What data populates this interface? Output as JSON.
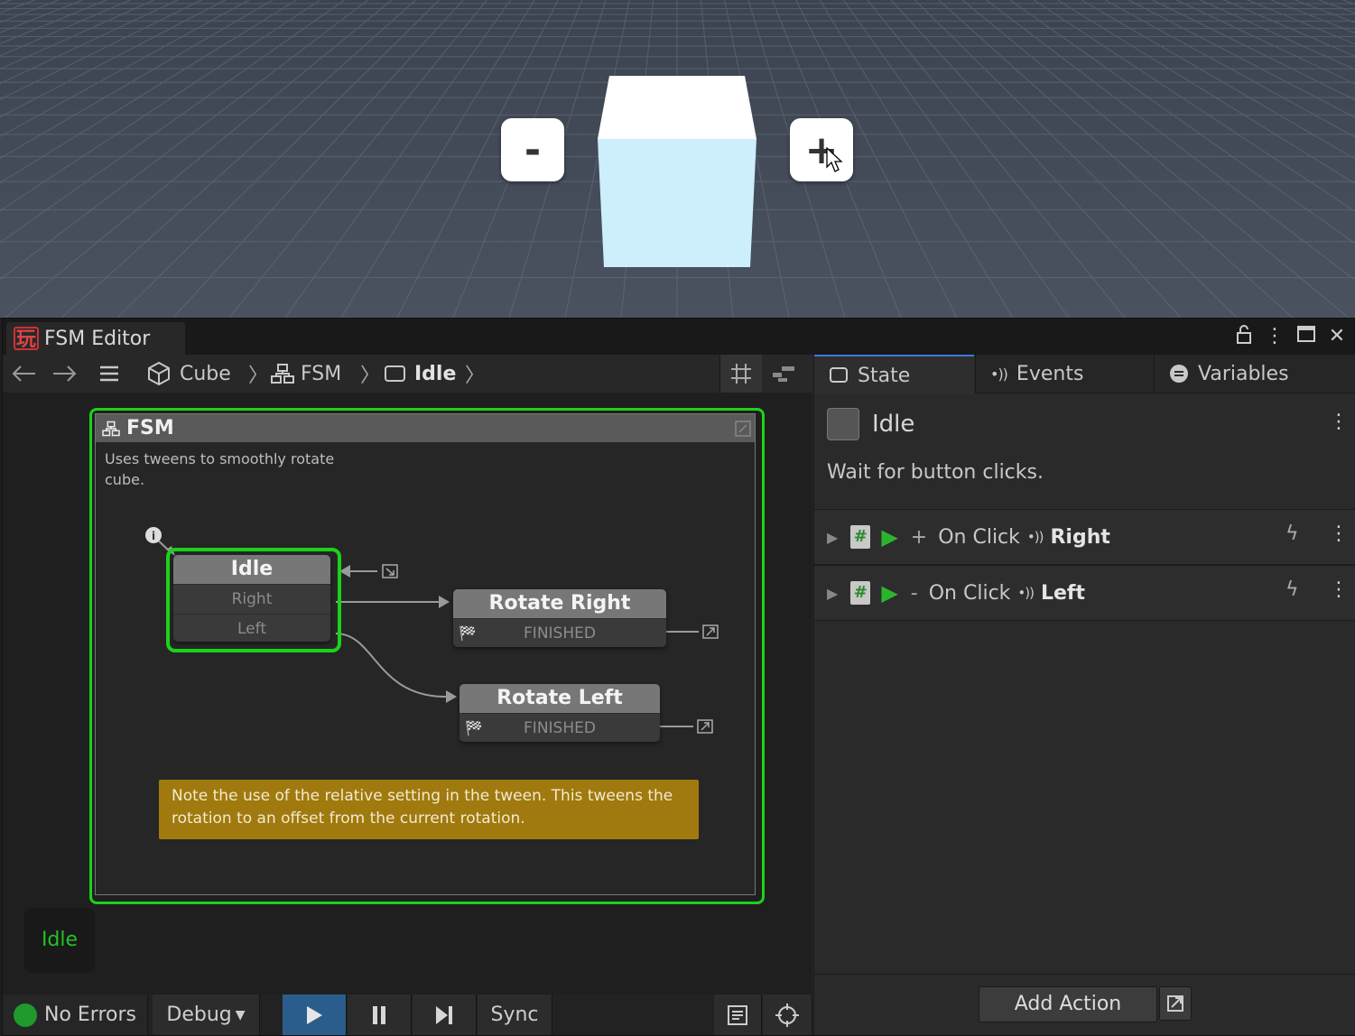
{
  "scene": {
    "minus_label": "-",
    "plus_label": "+"
  },
  "window": {
    "tab_title": "FSM Editor",
    "logo_char": "玩",
    "controls": [
      "lock-icon",
      "more-icon",
      "maximize-icon",
      "close-icon"
    ]
  },
  "toolbar": {
    "breadcrumbs": [
      "Cube",
      "FSM",
      "Idle"
    ]
  },
  "graph": {
    "fsm_title": "FSM",
    "fsm_description": "Uses tweens to smoothly rotate cube.",
    "states": {
      "idle": {
        "name": "Idle",
        "transitions": [
          "Right",
          "Left"
        ]
      },
      "rotate_right": {
        "name": "Rotate Right",
        "transitions": [
          "FINISHED"
        ]
      },
      "rotate_left": {
        "name": "Rotate Left",
        "transitions": [
          "FINISHED"
        ]
      }
    },
    "note": "Note the use of the relative setting in the tween. This tweens the rotation to an offset from the current rotation.",
    "active_state_badge": "Idle"
  },
  "bottombar": {
    "status": "No Errors",
    "debug_label": "Debug",
    "sync_label": "Sync",
    "status_color": "#1f9a2a",
    "play_active_color": "#2b5d8c"
  },
  "inspector": {
    "tabs": [
      "State",
      "Events",
      "Variables"
    ],
    "state_name": "Idle",
    "state_description": "Wait for button clicks.",
    "actions": [
      {
        "prefix": "+",
        "label": "On Click",
        "event": "Right"
      },
      {
        "prefix": "-",
        "label": "On Click",
        "event": "Left"
      }
    ],
    "add_action_label": "Add Action"
  },
  "colors": {
    "selection_green": "#1bd21b",
    "note_bg": "#a07a0e",
    "cube_front": "#cdeefc"
  }
}
